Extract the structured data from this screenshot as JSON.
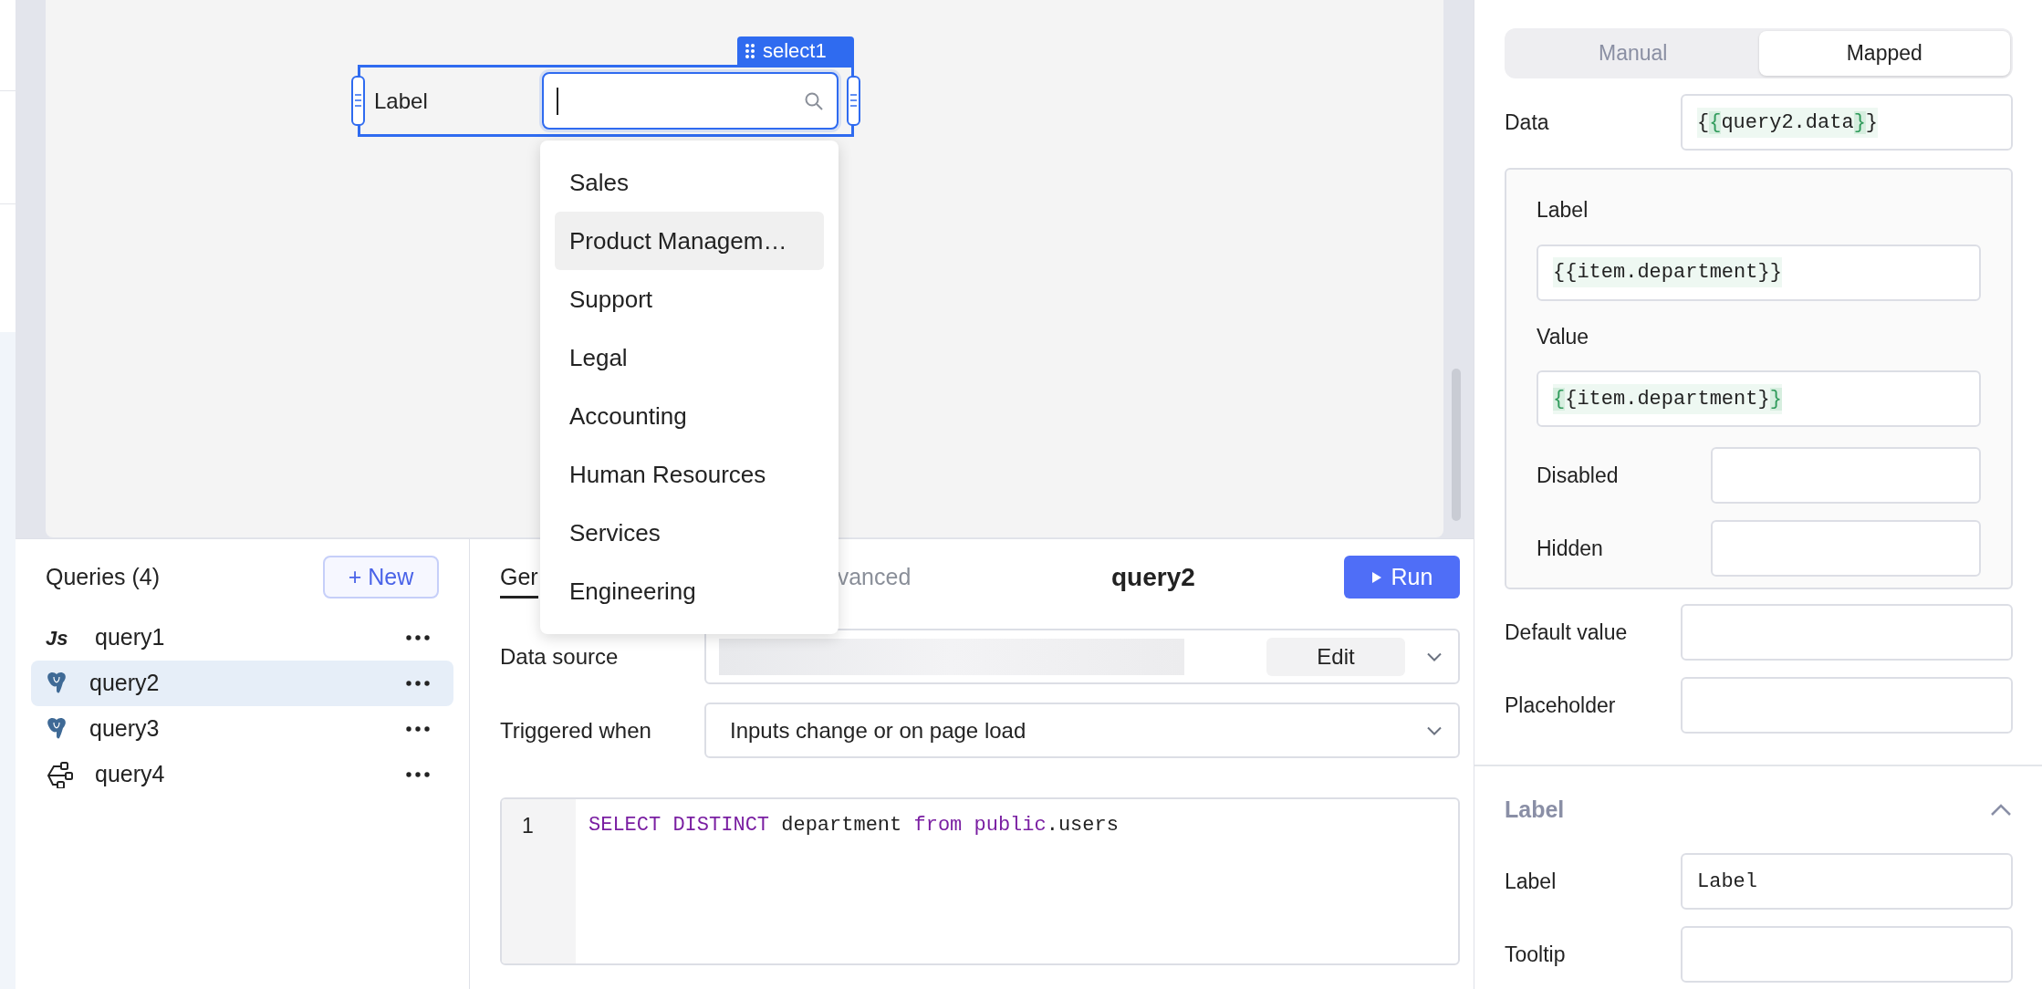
{
  "canvas": {
    "component": {
      "name": "select1",
      "label": "Label",
      "options": [
        {
          "label": "Sales",
          "highlighted": false
        },
        {
          "label": "Product Managem…",
          "highlighted": true
        },
        {
          "label": "Support",
          "highlighted": false
        },
        {
          "label": "Legal",
          "highlighted": false
        },
        {
          "label": "Accounting",
          "highlighted": false
        },
        {
          "label": "Human Resources",
          "highlighted": false
        },
        {
          "label": "Services",
          "highlighted": false
        },
        {
          "label": "Engineering",
          "highlighted": false
        }
      ]
    }
  },
  "queries_panel": {
    "title": "Queries (4)",
    "new_button": "+ New",
    "items": [
      {
        "name": "query1",
        "kind": "js",
        "icon_text": "Js",
        "selected": false
      },
      {
        "name": "query2",
        "kind": "postgres",
        "selected": true
      },
      {
        "name": "query3",
        "kind": "postgres",
        "selected": false
      },
      {
        "name": "query4",
        "kind": "workflow",
        "selected": false
      }
    ]
  },
  "editor": {
    "tabs": [
      {
        "label": "Ger",
        "selected": true
      },
      {
        "label": "vanced",
        "selected": false
      }
    ],
    "title": "query2",
    "run_button": "Run",
    "fields": [
      {
        "label": "Data source",
        "kind": "resource",
        "button": "Edit"
      },
      {
        "label": "Triggered when",
        "kind": "select",
        "value": "Inputs change or on page load"
      }
    ],
    "code_lines": [
      {
        "number": "1",
        "tokens": [
          {
            "kind": "keyword",
            "text": "SELECT DISTINCT"
          },
          {
            "kind": "plain",
            "text": " department "
          },
          {
            "kind": "keyword",
            "text": "from public"
          },
          {
            "kind": "plain",
            "text": ".users"
          }
        ]
      }
    ]
  },
  "inspector": {
    "mode_toggle": [
      {
        "label": "Manual",
        "selected": false
      },
      {
        "label": "Mapped",
        "selected": true
      }
    ],
    "data": {
      "label": "Data",
      "segments": [
        {
          "text": "{",
          "highlighted": false
        },
        {
          "text": "{",
          "highlighted": true
        },
        {
          "text": "query2.data",
          "highlighted": false
        },
        {
          "text": "}",
          "highlighted": true
        },
        {
          "text": "}",
          "highlighted": false
        }
      ]
    },
    "mapping": [
      {
        "label": "Label",
        "kind": "stacked",
        "segments": [
          {
            "text": "{{item.department}}",
            "highlighted": false
          }
        ]
      },
      {
        "label": "Value",
        "kind": "stacked",
        "segments": [
          {
            "text": "{",
            "highlighted": true
          },
          {
            "text": "{item.department}",
            "highlighted": false
          },
          {
            "text": "}",
            "highlighted": true
          }
        ]
      },
      {
        "label": "Disabled",
        "kind": "inline"
      },
      {
        "label": "Hidden",
        "kind": "inline"
      }
    ],
    "fields": [
      {
        "label": "Default value"
      },
      {
        "label": "Placeholder"
      }
    ],
    "sections": [
      {
        "title": "Label",
        "expanded": true,
        "fields": [
          {
            "label": "Label",
            "value": "Label"
          },
          {
            "label": "Tooltip"
          }
        ]
      }
    ]
  }
}
